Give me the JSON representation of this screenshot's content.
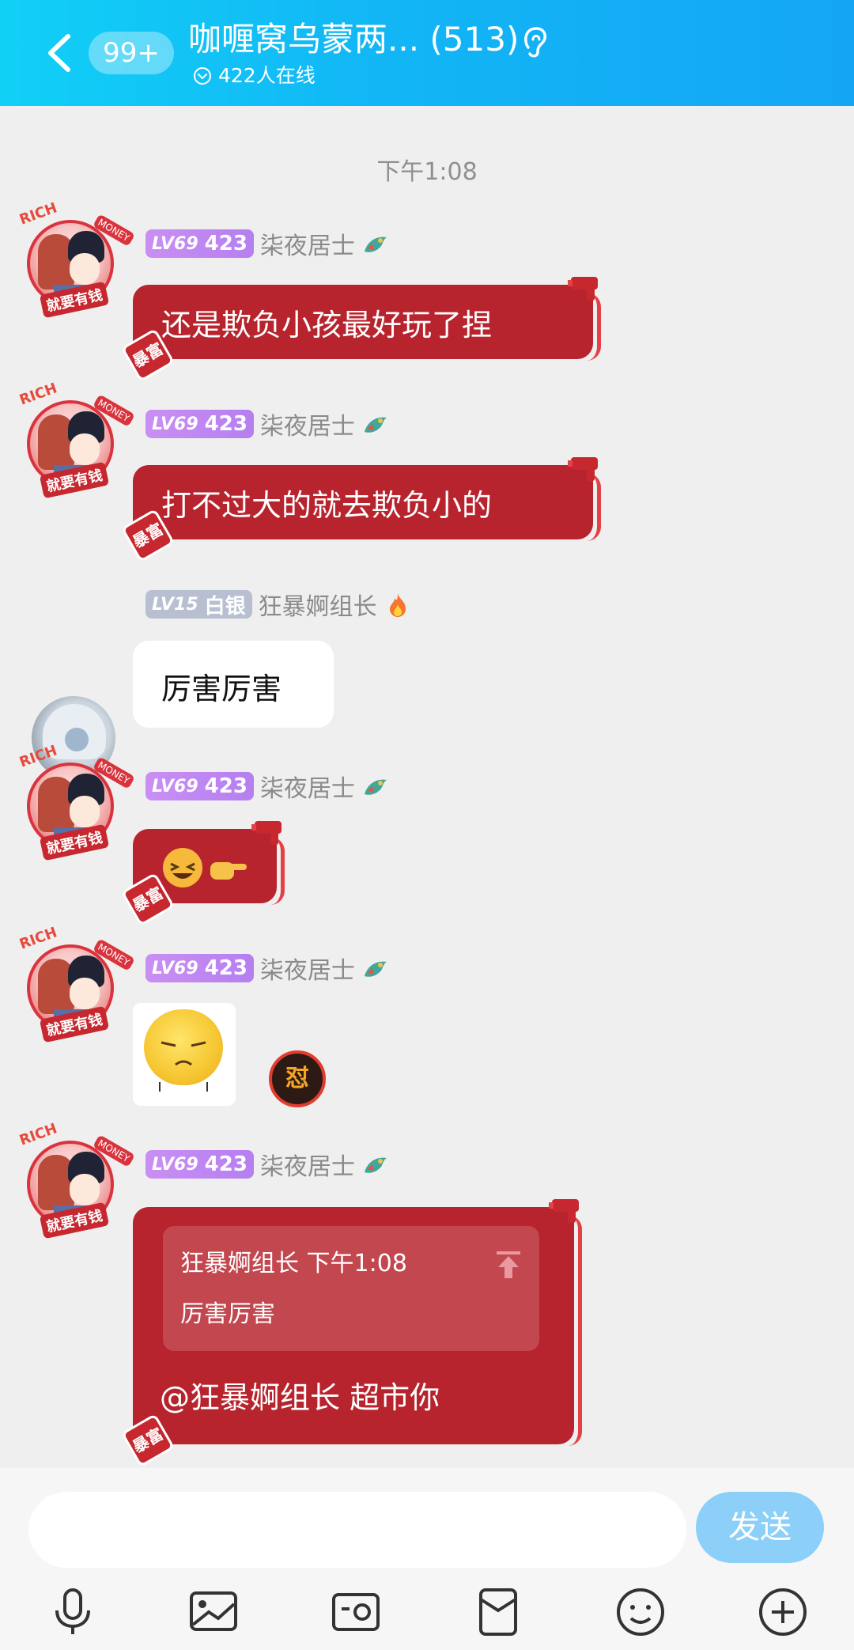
{
  "header": {
    "unread_badge": "99+",
    "group_title": "咖喱窝乌蒙两... (513)",
    "online_text": "422人在线"
  },
  "chat": {
    "time_divider": "下午1:08",
    "sender_a": {
      "level_text": "LV69",
      "level_number": "423",
      "nickname": "柒夜居士",
      "avatar_text_rich": "RICH",
      "avatar_text_money": "MONEY",
      "avatar_text_slogan": "就要有钱",
      "bubble_stamp": "暴富"
    },
    "sender_b": {
      "level_text": "LV15",
      "level_rank": "白银",
      "nickname": "狂暴婀组长"
    },
    "messages": [
      {
        "sender": "sender_a",
        "text": "还是欺负小孩最好玩了捏"
      },
      {
        "sender": "sender_a",
        "text": "打不过大的就去欺负小的"
      },
      {
        "sender": "sender_b",
        "text": "厉害厉害"
      },
      {
        "sender": "sender_a",
        "emoji": [
          "laughing-face",
          "pointing-hand"
        ]
      },
      {
        "sender": "sender_a",
        "sticker": "annoyed-face",
        "badge_text": "怼"
      },
      {
        "sender": "sender_a",
        "quote_author": "狂暴婀组长",
        "quote_time": "下午1:08",
        "quote_text": "厉害厉害",
        "text": "@狂暴婀组长 超市你"
      }
    ]
  },
  "bottom": {
    "input_value": "",
    "send_label": "发送",
    "toolbar_icons": [
      "microphone-icon",
      "image-icon",
      "camera-icon",
      "red-packet-icon",
      "emoji-icon",
      "plus-icon"
    ]
  },
  "colors": {
    "header_gradient_start": "#11d0f6",
    "header_gradient_end": "#14a6f5",
    "bubble_red": "#b8242e",
    "send_button": "#8ccff8",
    "level_purple": "#c98ff3",
    "level_silver": "#b8bfd0"
  }
}
